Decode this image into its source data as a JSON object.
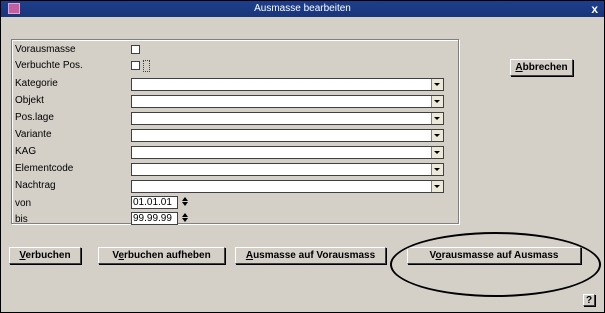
{
  "window": {
    "title": "Ausmasse bearbeiten",
    "close_label": "x"
  },
  "form": {
    "fields": [
      {
        "label": "Vorausmasse"
      },
      {
        "label": "Verbuchte Pos."
      },
      {
        "label": "Kategorie",
        "value": ""
      },
      {
        "label": "Objekt",
        "value": ""
      },
      {
        "label": "Pos.lage",
        "value": ""
      },
      {
        "label": "Variante",
        "value": ""
      },
      {
        "label": "KAG",
        "value": ""
      },
      {
        "label": "Elementcode",
        "value": ""
      },
      {
        "label": "Nachtrag",
        "value": ""
      },
      {
        "label": "von",
        "value": "01.01.01"
      },
      {
        "label": "bis",
        "value": "99.99.99"
      }
    ]
  },
  "buttons": {
    "cancel": {
      "underline": "A",
      "rest": "bbrechen"
    },
    "verbuchen": {
      "underline": "V",
      "rest": "erbuchen"
    },
    "verbuchen_aufheben": {
      "pre": "V",
      "underline": "e",
      "rest": "rbuchen aufheben"
    },
    "ausmasse_auf_vorausmass": {
      "underline": "A",
      "rest": "usmasse auf Vorausmass"
    },
    "vorausmasse_auf_ausmass": {
      "pre": "V",
      "underline": "o",
      "rest": "rausmasse auf Ausmass"
    }
  },
  "help": {
    "label": "?"
  },
  "colors": {
    "titlebar": "#1c3f8c",
    "window_bg": "#d4d0c8",
    "annotation": "#000000"
  }
}
